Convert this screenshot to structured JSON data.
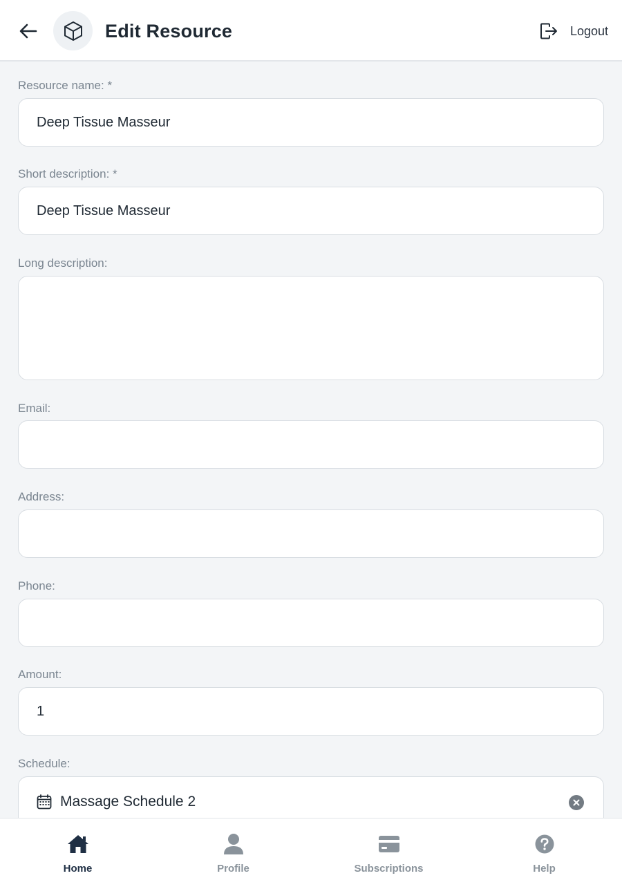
{
  "header": {
    "title": "Edit Resource",
    "logout_label": "Logout",
    "back_icon": "arrow-left-icon",
    "resource_icon": "cube-icon"
  },
  "form": {
    "resource_name": {
      "label": "Resource name: *",
      "value": "Deep Tissue Masseur"
    },
    "short_description": {
      "label": "Short description: *",
      "value": "Deep Tissue Masseur"
    },
    "long_description": {
      "label": "Long description:",
      "value": ""
    },
    "email": {
      "label": "Email:",
      "value": ""
    },
    "address": {
      "label": "Address:",
      "value": ""
    },
    "phone": {
      "label": "Phone:",
      "value": ""
    },
    "amount": {
      "label": "Amount:",
      "value": "1"
    },
    "schedule": {
      "label": "Schedule:",
      "value": "Massage Schedule 2"
    }
  },
  "bottom_nav": {
    "items": [
      {
        "label": "Home",
        "icon": "home-icon",
        "active": true
      },
      {
        "label": "Profile",
        "icon": "person-icon",
        "active": false
      },
      {
        "label": "Subscriptions",
        "icon": "card-icon",
        "active": false
      },
      {
        "label": "Help",
        "icon": "help-icon",
        "active": false
      }
    ]
  },
  "colors": {
    "background": "#f3f5f7",
    "surface": "#ffffff",
    "text_primary": "#1f2933",
    "label_muted": "#7a8590",
    "nav_active": "#1f2f44",
    "nav_inactive": "#8a939b"
  }
}
